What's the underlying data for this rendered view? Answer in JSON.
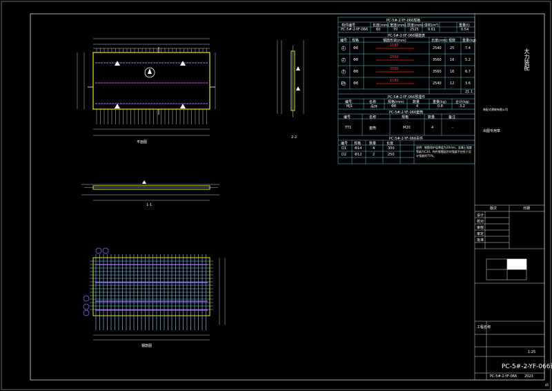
{
  "drawing_number": "PC-5#-2-YF-066",
  "page_number": "45",
  "views": {
    "plan_label": "平面图",
    "section_11_label": "1-1",
    "section_22_label": "2-2",
    "rebar_label": "钢筋图"
  },
  "table1": {
    "title": "PC-5#-2-YF-066规格",
    "headers": [
      "构件编号",
      "长度(mm)",
      "宽度(mm)",
      "厚度(mm)",
      "体积(m³)",
      "重量(t)"
    ],
    "row": [
      "PC-5#-2-YF-066",
      "60",
      "70",
      "2525",
      "9.61",
      "0.54"
    ]
  },
  "table2": {
    "title": "PC-5#-2-YF-066钢筋表",
    "headers": [
      "编号",
      "规格",
      "钢筋形状(mm)",
      "长度(mm)",
      "根数",
      "重量(kg)"
    ],
    "rows": [
      [
        "1",
        "Φ8",
        "1180",
        "2540",
        "25",
        "7.4"
      ],
      [
        "2",
        "Φ8",
        "2500",
        "3560",
        "16",
        "5.2"
      ],
      [
        "3",
        "Φ8",
        "2500",
        "3560",
        "16",
        "6.7"
      ],
      [
        "1b",
        "Φ8",
        "1180",
        "2540",
        "12",
        "3.6"
      ]
    ],
    "total": "21.1"
  },
  "table3": {
    "title": "PC-5#-2-YF-066预埋件",
    "headers": [
      "编号",
      "名称",
      "规格(mm)",
      "数量",
      "重量(kg)",
      "合计(kg)"
    ],
    "row": [
      "MJ1",
      "吊环",
      "Φ8",
      "4",
      "0.8",
      "3.2"
    ]
  },
  "table4": {
    "title": "PC-5#-2-YF-066套筒",
    "headers": [
      "编号",
      "名称",
      "规格",
      "数量",
      "备注"
    ],
    "row": [
      "TT1",
      "套筒",
      "M20",
      "4",
      "-"
    ]
  },
  "table5": {
    "title": "PC-5#-2-YF-066吊件",
    "headers": [
      "编号",
      "规格",
      "数量",
      "长度"
    ],
    "rows": [
      [
        "D1",
        "Φ14",
        "4",
        "300"
      ],
      [
        "D2",
        "Φ12",
        "2",
        "250"
      ]
    ],
    "note": "说明：钢筋保护层厚度为20mm，混凝土强度等级为C30，构件脱模起吊时强度不应低于设计强度的75%。"
  },
  "title_block": {
    "company": "大力装配",
    "sub": "装配式建筑有限公司",
    "stamp": "出图专用章",
    "project_label": "工程名称",
    "review_rows": [
      "设计",
      "校对",
      "审核",
      "审定",
      "批准"
    ],
    "version_header": [
      "版次",
      "日期"
    ],
    "drawing_title": "PC-5#-2-YF-066详图",
    "scale": "1:25",
    "date": "2023"
  }
}
